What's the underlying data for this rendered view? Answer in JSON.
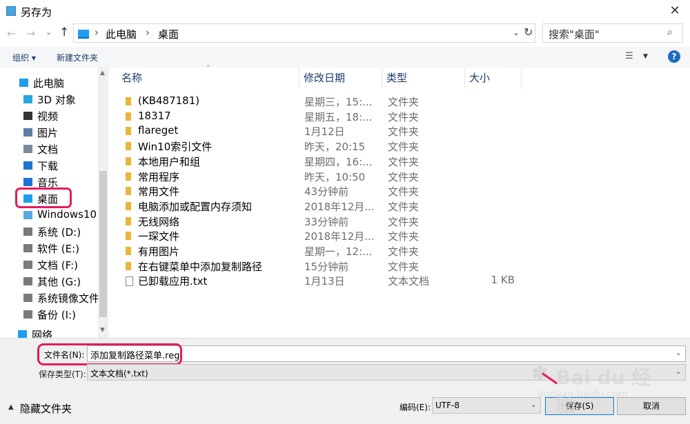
{
  "window": {
    "title": "另存为"
  },
  "address": {
    "parts": [
      "此电脑",
      "桌面"
    ],
    "search_placeholder": "搜索\"桌面\""
  },
  "toolbar": {
    "organize": "组织 ▾",
    "new_folder": "新建文件夹"
  },
  "nav": {
    "items": [
      {
        "label": "此电脑",
        "icon": "pc-icon",
        "color": "#1f9cf0"
      },
      {
        "label": "3D 对象",
        "icon": "cube-icon",
        "color": "#29a7e1"
      },
      {
        "label": "视频",
        "icon": "video-icon",
        "color": "#333333"
      },
      {
        "label": "图片",
        "icon": "picture-icon",
        "color": "#5b7fa7"
      },
      {
        "label": "文档",
        "icon": "document-icon",
        "color": "#7a8a99"
      },
      {
        "label": "下载",
        "icon": "download-icon",
        "color": "#1d73d2"
      },
      {
        "label": "音乐",
        "icon": "music-icon",
        "color": "#1d73d2"
      },
      {
        "label": "桌面",
        "icon": "desktop-icon",
        "color": "#1f9cf0"
      },
      {
        "label": "Windows10",
        "icon": "windows-drive-icon",
        "color": "#5aa9e6"
      },
      {
        "label": "系统 (D:)",
        "icon": "drive-icon",
        "color": "#7a7a7a"
      },
      {
        "label": "软件 (E:)",
        "icon": "drive-icon",
        "color": "#7a7a7a"
      },
      {
        "label": "文档 (F:)",
        "icon": "drive-icon",
        "color": "#7a7a7a"
      },
      {
        "label": "其他 (G:)",
        "icon": "drive-icon",
        "color": "#7a7a7a"
      },
      {
        "label": "系统镜像文件",
        "icon": "drive-icon",
        "color": "#7a7a7a"
      },
      {
        "label": "备份 (I:)",
        "icon": "drive-icon",
        "color": "#7a7a7a"
      },
      {
        "label": "网络",
        "icon": "network-icon",
        "color": "#1f9cf0"
      }
    ]
  },
  "columns": {
    "name": "名称",
    "date": "修改日期",
    "type": "类型",
    "size": "大小"
  },
  "files": [
    {
      "name": "(KB487181)",
      "date": "星期三，15:...",
      "type": "文件夹",
      "size": ""
    },
    {
      "name": "18317",
      "date": "星期五，18:...",
      "type": "文件夹",
      "size": ""
    },
    {
      "name": "flareget",
      "date": "1月12日",
      "type": "文件夹",
      "size": ""
    },
    {
      "name": "Win10索引文件",
      "date": "昨天，20:15",
      "type": "文件夹",
      "size": ""
    },
    {
      "name": "本地用户和组",
      "date": "星期四，16:...",
      "type": "文件夹",
      "size": ""
    },
    {
      "name": "常用程序",
      "date": "昨天，10:50",
      "type": "文件夹",
      "size": ""
    },
    {
      "name": "常用文件",
      "date": "43分钟前",
      "type": "文件夹",
      "size": ""
    },
    {
      "name": "电脑添加或配置内存须知",
      "date": "2018年12月...",
      "type": "文件夹",
      "size": ""
    },
    {
      "name": "无线网络",
      "date": "33分钟前",
      "type": "文件夹",
      "size": ""
    },
    {
      "name": "一琛文件",
      "date": "2018年12月...",
      "type": "文件夹",
      "size": ""
    },
    {
      "name": "有用图片",
      "date": "星期一，12:...",
      "type": "文件夹",
      "size": ""
    },
    {
      "name": "在右键菜单中添加复制路径",
      "date": "15分钟前",
      "type": "文件夹",
      "size": ""
    },
    {
      "name": "已卸载应用.txt",
      "date": "1月13日",
      "type": "文本文档",
      "size": "1 KB"
    }
  ],
  "form": {
    "filename_label": "文件名(N):",
    "filename_value": "添加复制路径菜单.reg",
    "filetype_label": "保存类型(T):",
    "filetype_value": "文本文档(*.txt)",
    "hide_folders": "隐藏文件夹",
    "encoding_label": "编码(E):",
    "encoding_value": "UTF-8",
    "save": "保存(S)",
    "cancel": "取消"
  },
  "watermark": {
    "text": "Bai du 经验",
    "url": "jingyan.baidu.com"
  },
  "colors": {
    "highlight": "#e8195a",
    "folder": "#e8b63a",
    "accent": "#0078d7"
  }
}
